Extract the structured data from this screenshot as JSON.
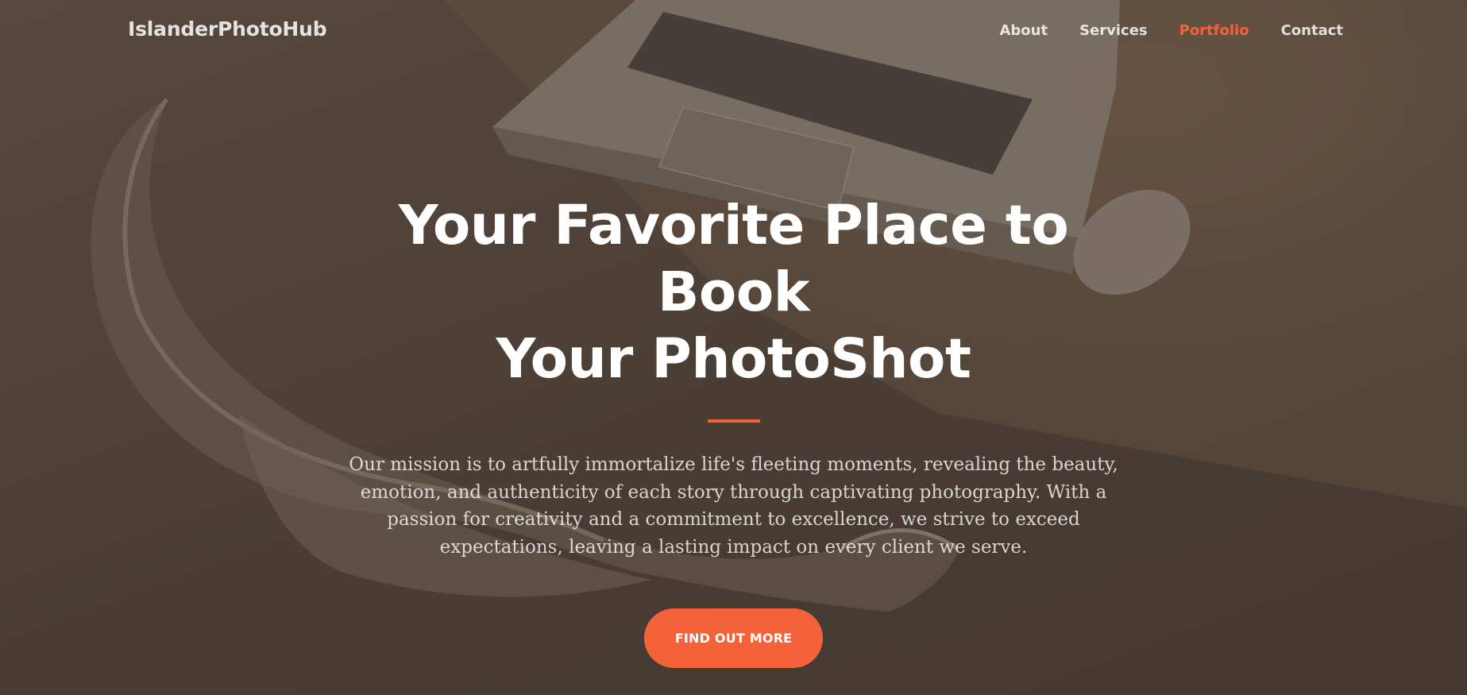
{
  "nav": {
    "brand": "IslanderPhotoHub",
    "links": [
      {
        "label": "About",
        "active": false
      },
      {
        "label": "Services",
        "active": false
      },
      {
        "label": "Portfolio",
        "active": true
      },
      {
        "label": "Contact",
        "active": false
      }
    ]
  },
  "hero": {
    "title_line1": "Your Favorite Place to Book",
    "title_line2": "Your PhotoShot",
    "text": "Our mission is to artfully immortalize life's fleeting moments, revealing the beauty, emotion, and authenticity of each story through captivating photography. With a passion for creativity and a commitment to excellence, we strive to exceed expectations, leaving a lasting impact on every client we serve.",
    "cta_label": "Find Out More"
  },
  "colors": {
    "accent": "#f4623a",
    "overlay": "#4b3f37"
  }
}
